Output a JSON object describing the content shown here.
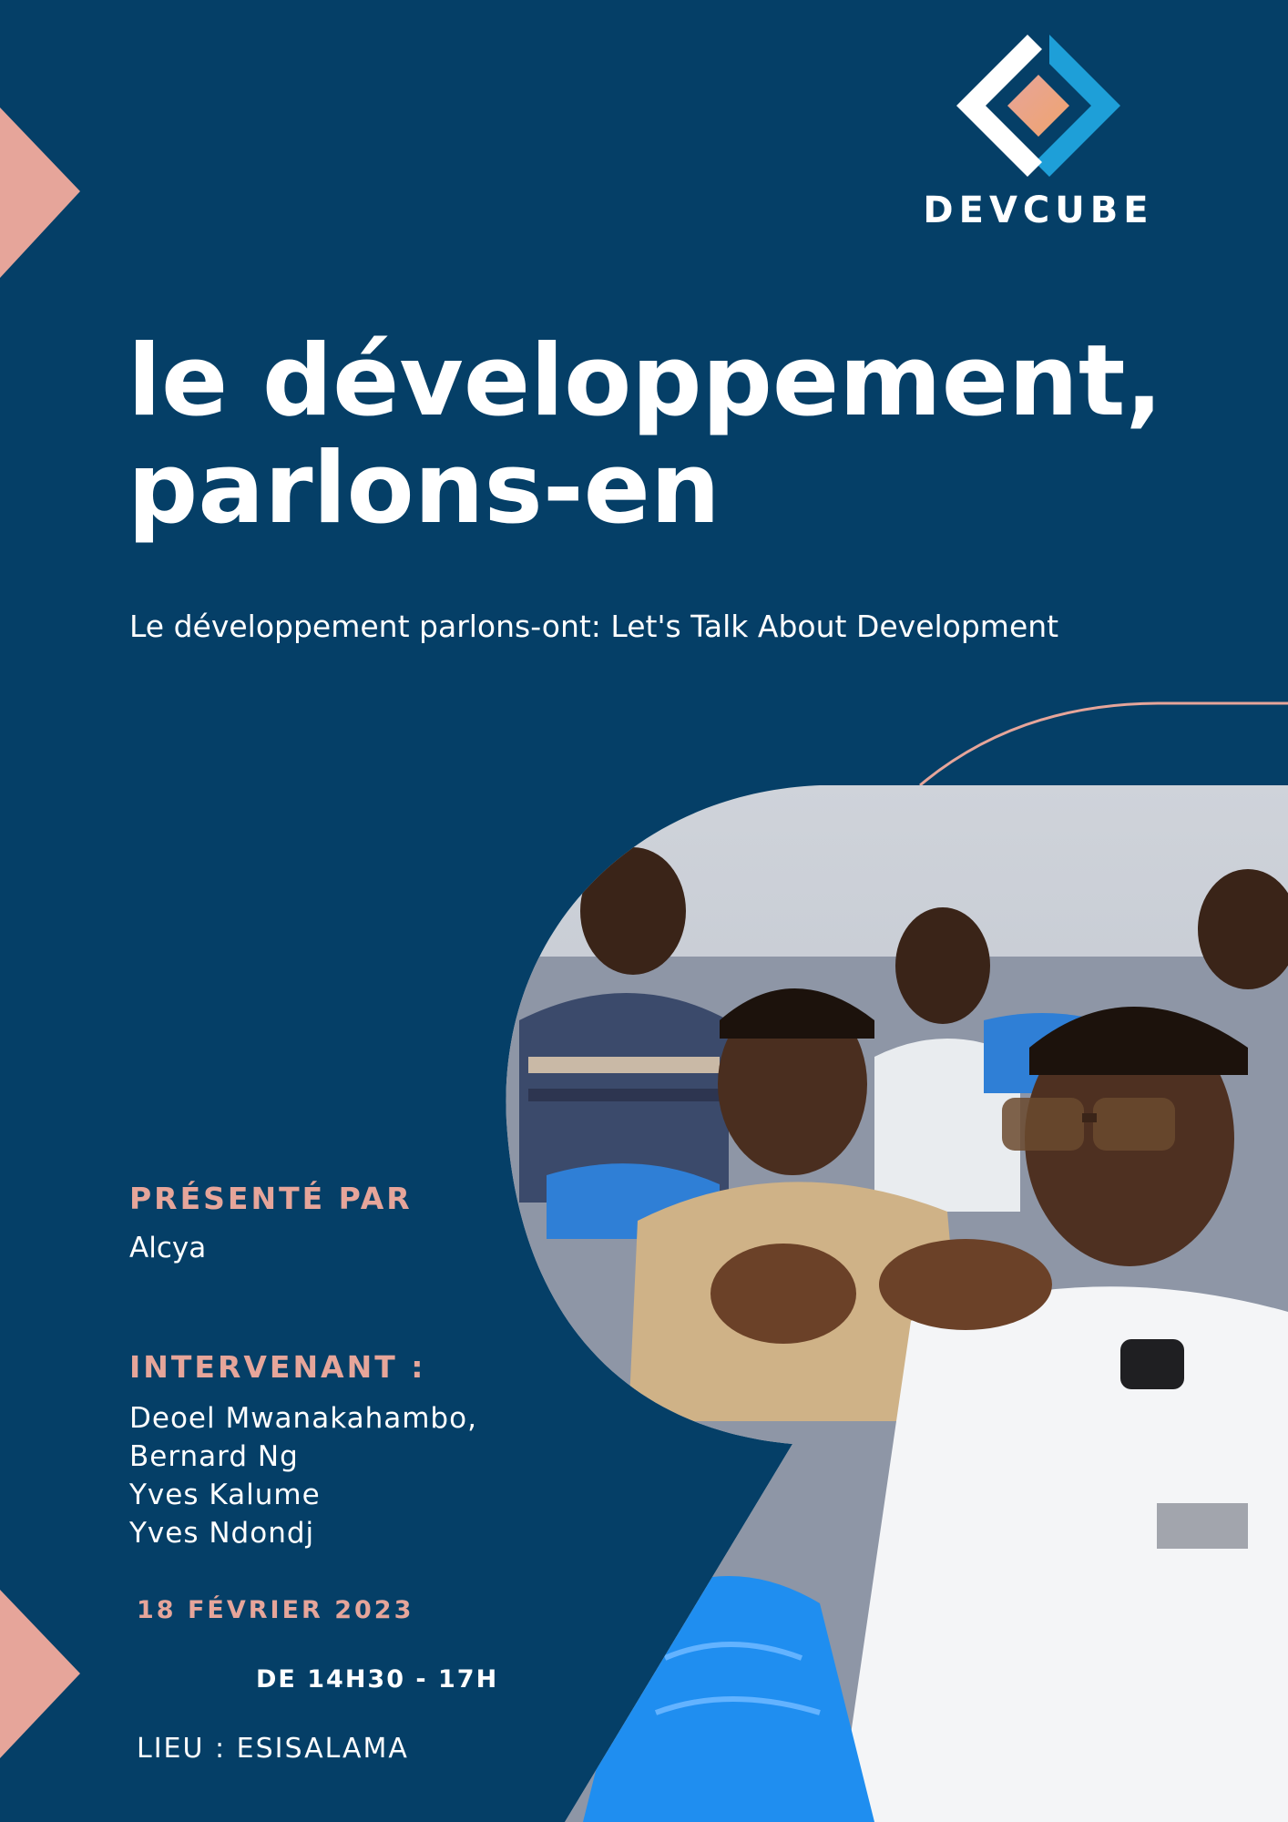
{
  "brand": {
    "name": "DEVCUBE",
    "logo_icon": "nested-diamond-logo-icon",
    "colors": {
      "blue": "#1e9fd8",
      "white": "#ffffff",
      "pink": "#e6a59a",
      "orange": "#f0a36e"
    }
  },
  "colors": {
    "background": "#053f67",
    "accent": "#e6a59a",
    "text": "#ffffff"
  },
  "title": {
    "line1": "le développement,",
    "line2": "parlons-en"
  },
  "subtitle": "Le développement parlons-ont: Let's Talk About Development",
  "presenter": {
    "label": "PRÉSENTÉ PAR",
    "name": "Alcya"
  },
  "speakers": {
    "label": "INTERVENANT :",
    "names": [
      "Deoel Mwanakahambo,",
      "Bernard Ng",
      "Yves Kalume",
      "Yves Ndondj"
    ]
  },
  "event": {
    "date": "18 FÉVRIER 2023",
    "time": "DE 14H30 - 17H",
    "venue": "LIEU : ESISALAMA"
  },
  "photo": {
    "icon": "audience-photo",
    "subject": "young men seated on blue plastic chairs, one gesturing with both hands"
  }
}
